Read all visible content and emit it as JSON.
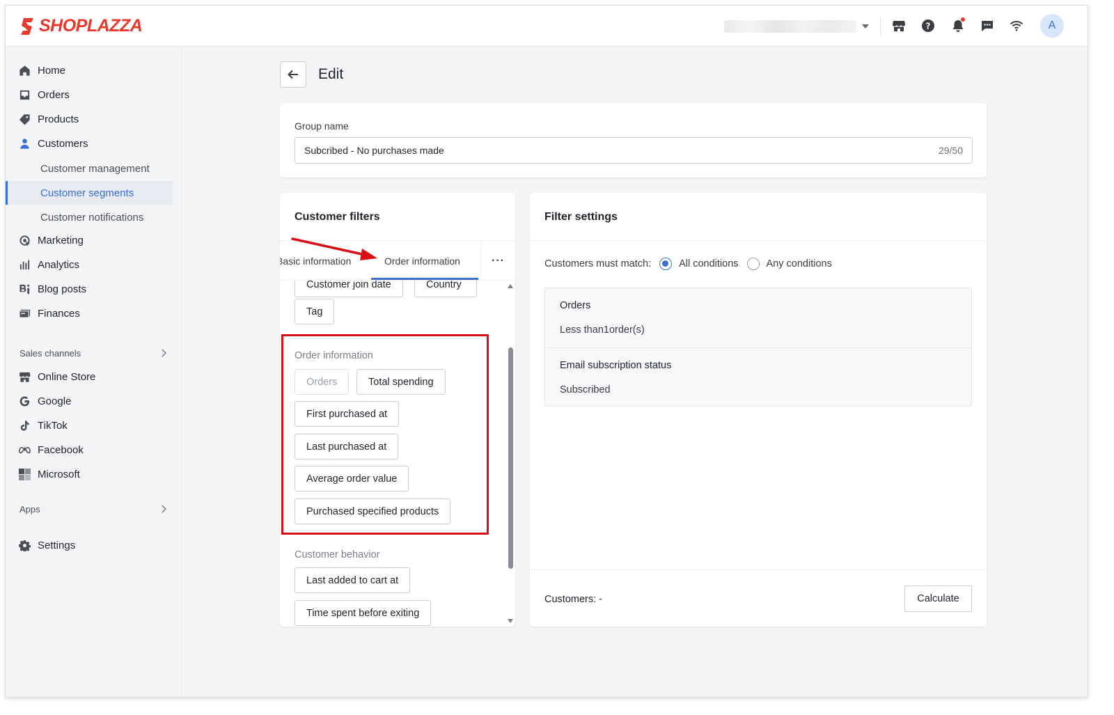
{
  "brand": {
    "name": "SHOPLAZZA",
    "color": "#e8372d"
  },
  "topbar": {
    "avatar_letter": "A",
    "icons": [
      "store-icon",
      "help-icon",
      "bell-icon",
      "chat-icon",
      "wifi-icon"
    ]
  },
  "sidebar": {
    "items": [
      {
        "label": "Home",
        "icon": "home-icon"
      },
      {
        "label": "Orders",
        "icon": "inbox-icon"
      },
      {
        "label": "Products",
        "icon": "tag-icon"
      },
      {
        "label": "Customers",
        "icon": "person-icon"
      }
    ],
    "customer_sub": [
      {
        "label": "Customer management"
      },
      {
        "label": "Customer segments",
        "selected": true
      },
      {
        "label": "Customer notifications"
      }
    ],
    "items2": [
      {
        "label": "Marketing",
        "icon": "marketing-icon"
      },
      {
        "label": "Analytics",
        "icon": "analytics-icon"
      },
      {
        "label": "Blog posts",
        "icon": "blog-icon"
      },
      {
        "label": "Finances",
        "icon": "finances-icon"
      }
    ],
    "sales_channels_label": "Sales channels",
    "channels": [
      {
        "label": "Online Store",
        "icon": "store-icon"
      },
      {
        "label": "Google",
        "icon": "google-icon"
      },
      {
        "label": "TikTok",
        "icon": "tiktok-icon"
      },
      {
        "label": "Facebook",
        "icon": "meta-icon"
      },
      {
        "label": "Microsoft",
        "icon": "microsoft-icon"
      }
    ],
    "apps_label": "Apps",
    "settings_label": "Settings"
  },
  "page": {
    "title": "Edit",
    "group_name_label": "Group name",
    "group_name_value": "Subcribed - No purchases made",
    "group_name_count": "29/50"
  },
  "filters": {
    "title": "Customer filters",
    "tabs": [
      "Basic information",
      "Order information"
    ],
    "more": "···",
    "partial_buttons": [
      "Customer join date",
      "Country"
    ],
    "tag_button": "Tag",
    "order_group_label": "Order information",
    "order_buttons": [
      "Orders",
      "Total spending",
      "First purchased at",
      "Last purchased at",
      "Average order value",
      "Purchased specified products"
    ],
    "behavior_group_label": "Customer behavior",
    "behavior_buttons": [
      "Last added to cart at",
      "Time spent before exiting"
    ]
  },
  "settings": {
    "title": "Filter settings",
    "match_label": "Customers must match:",
    "match_all": "All conditions",
    "match_any": "Any conditions",
    "match_selected": "all",
    "conditions": [
      {
        "title": "Orders",
        "value": "Less than1order(s)"
      },
      {
        "title": "Email subscription status",
        "value": "Subscribed"
      }
    ],
    "customers_label": "Customers: -",
    "calculate_label": "Calculate"
  },
  "colors": {
    "accent": "#3b6fd4",
    "highlight_box": "#d90f16",
    "arrow": "#d90f16"
  }
}
